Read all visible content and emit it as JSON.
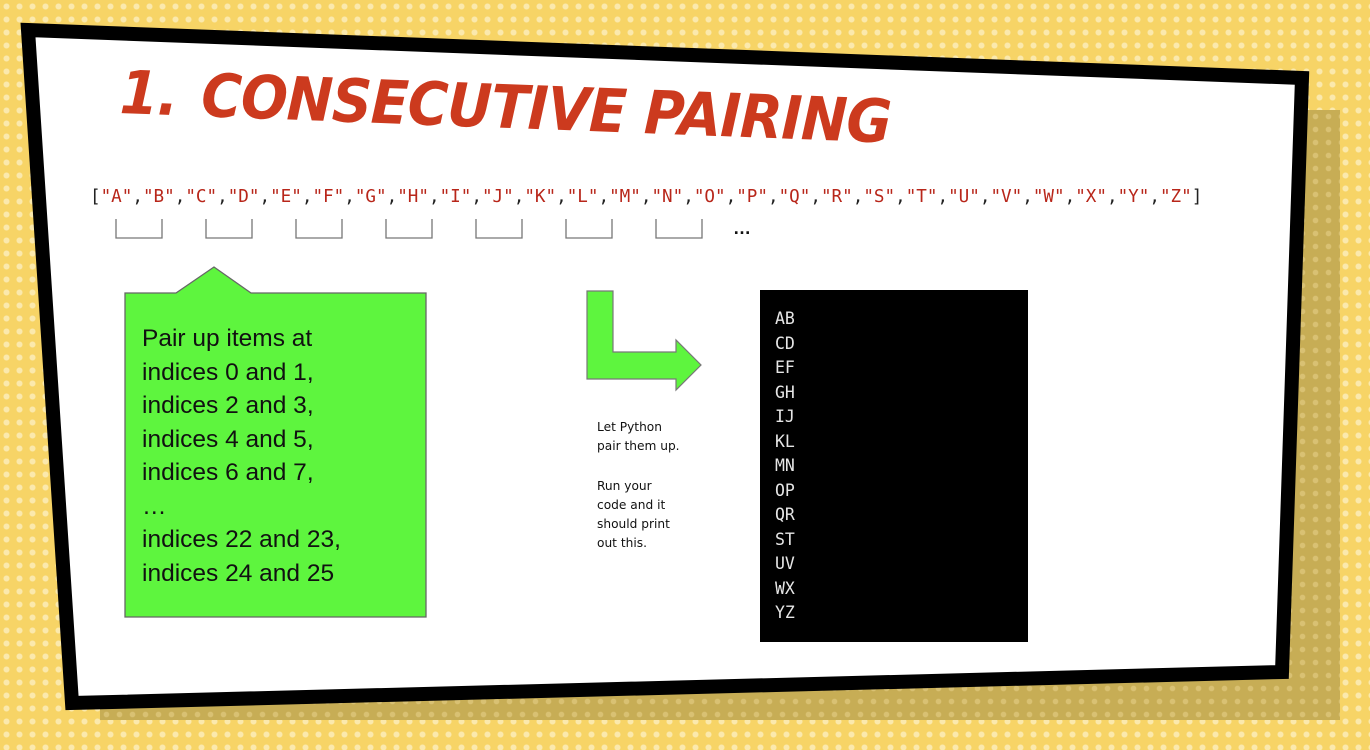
{
  "slide": {
    "title_number": "1.",
    "title_text": "Consecutive Pairing",
    "letters": [
      "A",
      "B",
      "C",
      "D",
      "E",
      "F",
      "G",
      "H",
      "I",
      "J",
      "K",
      "L",
      "M",
      "N",
      "O",
      "P",
      "Q",
      "R",
      "S",
      "T",
      "U",
      "V",
      "W",
      "X",
      "Y",
      "Z"
    ],
    "list_open": "[",
    "list_close": "]",
    "ellipsis": "…",
    "callout_lines": [
      "Pair up items at",
      "indices 0 and 1,",
      "indices 2 and 3,",
      "indices 4 and 5,",
      "indices 6 and 7,",
      "…",
      "indices 22 and 23,",
      "indices 24 and 25"
    ],
    "note_1_lines": [
      "Let Python",
      "pair them up."
    ],
    "note_2_lines": [
      "Run your",
      "code and it",
      "should print",
      "out this."
    ],
    "terminal_output": [
      "AB",
      "CD",
      "EF",
      "GH",
      "IJ",
      "KL",
      "MN",
      "OP",
      "QR",
      "ST",
      "UV",
      "WX",
      "YZ"
    ]
  },
  "colors": {
    "background": "#f7d466",
    "title": "#cc3a1e",
    "string_literal": "#b8261a",
    "callout_fill": "#5ef53e",
    "terminal_bg": "#000000"
  }
}
